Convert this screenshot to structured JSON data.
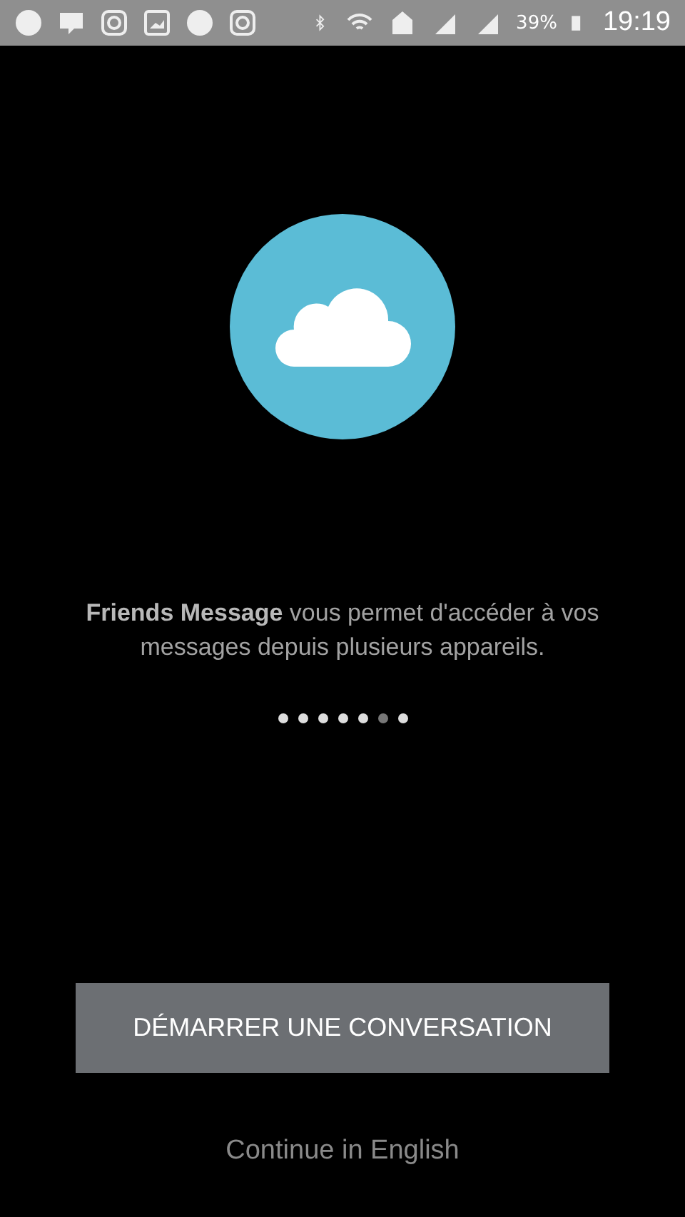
{
  "status_bar": {
    "battery": "39%",
    "time": "19:19"
  },
  "intro": {
    "text": "**Friends Message** vous permet d'accéder à vos messages depuis plusieurs appareils."
  },
  "pager": [
    {
      "selected": false
    },
    {
      "selected": false
    },
    {
      "selected": false
    },
    {
      "selected": false
    },
    {
      "selected": false
    },
    {
      "selected": true
    },
    {
      "selected": false
    }
  ],
  "start_button": {
    "label": "DÉMARRER UNE CONVERSATION"
  },
  "language_link": {
    "label": "Continue in English"
  }
}
